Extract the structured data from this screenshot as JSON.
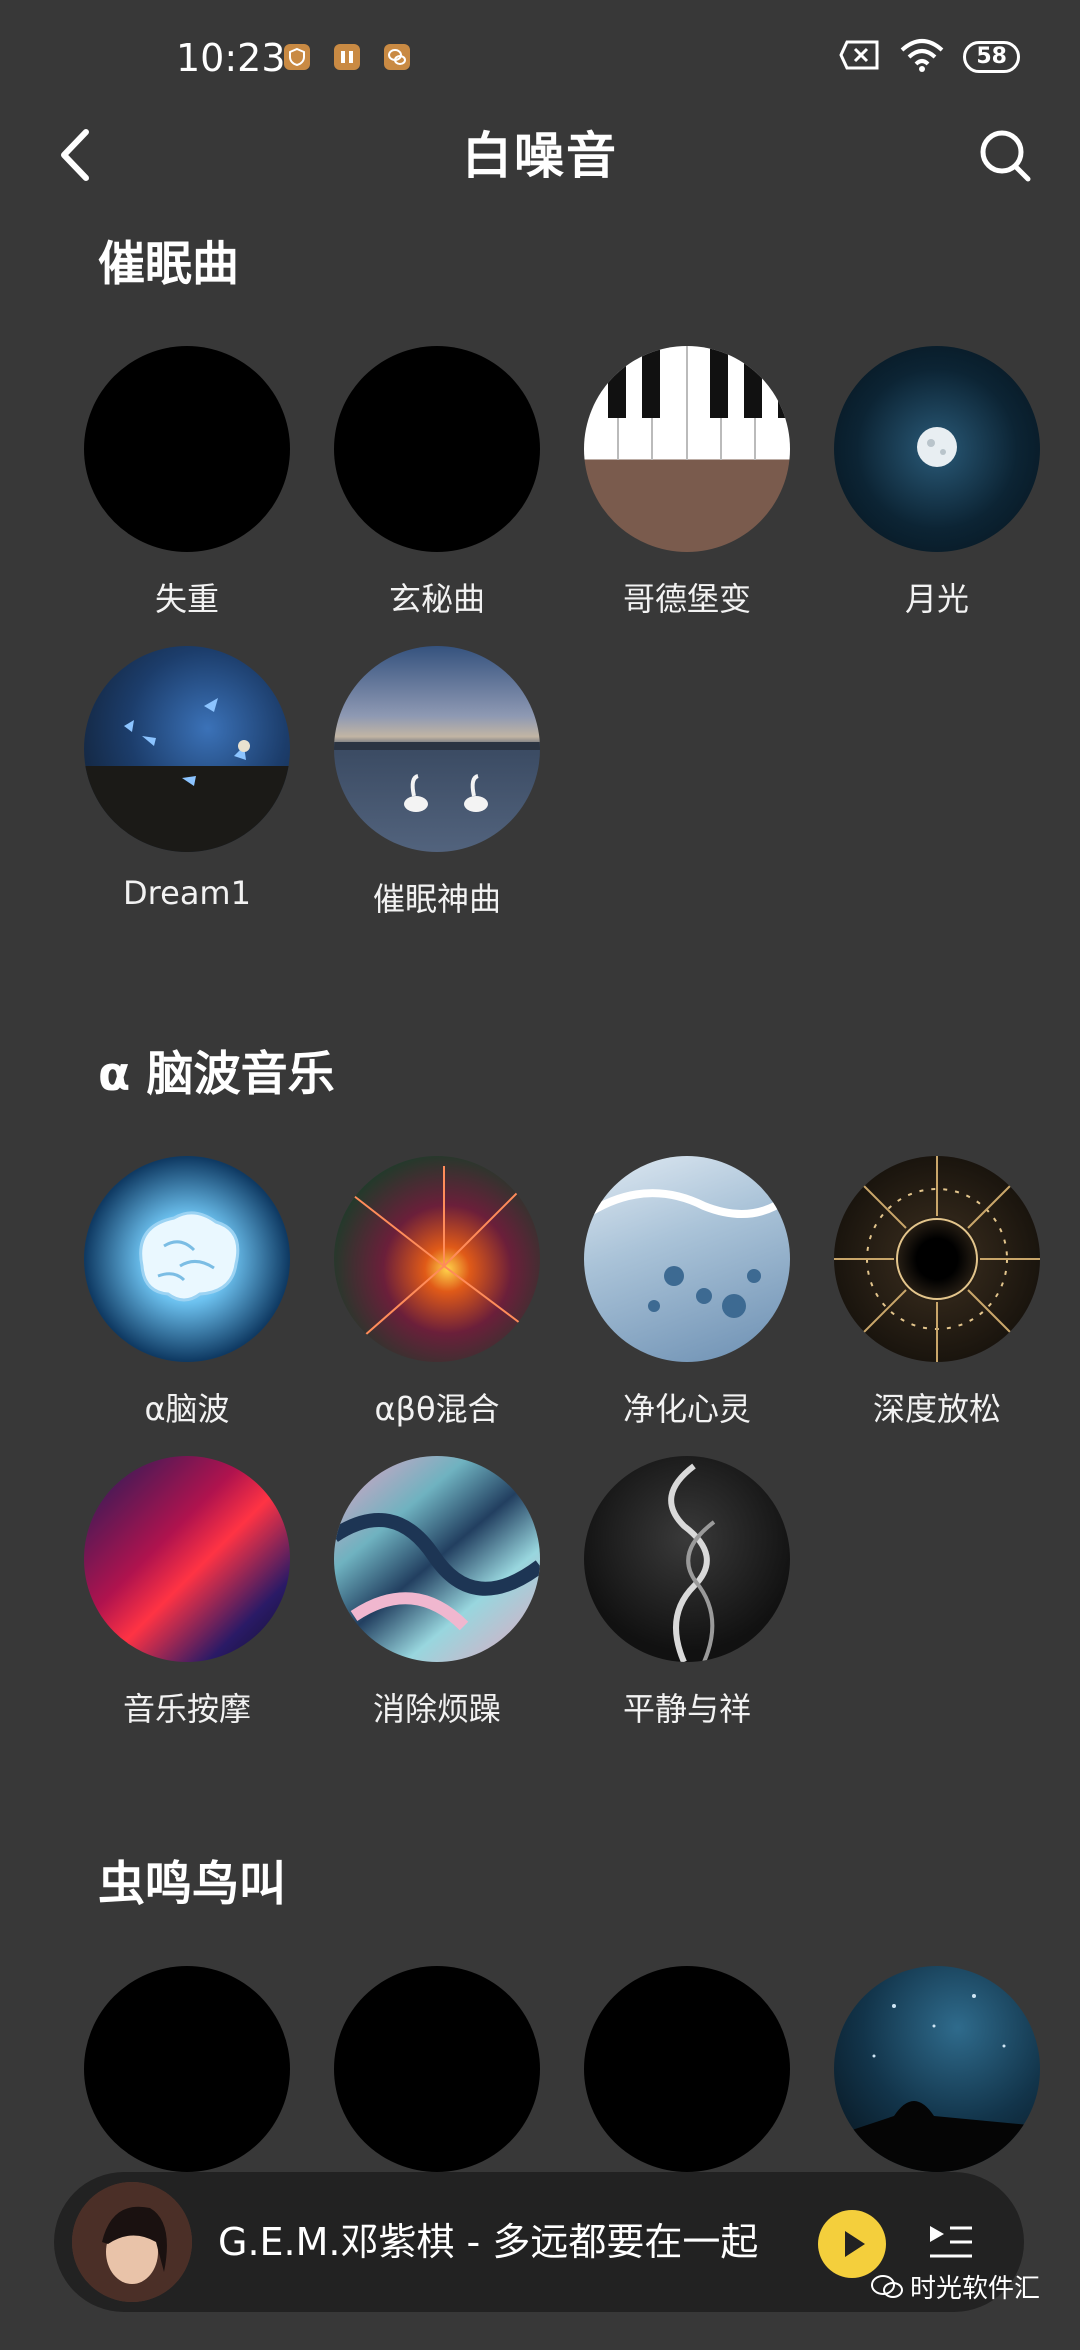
{
  "status_bar": {
    "time": "10:23",
    "battery": "58"
  },
  "header": {
    "title": "白噪音"
  },
  "sections": [
    {
      "title": "催眠曲",
      "items": [
        "失重",
        "玄秘曲",
        "哥德堡变",
        "月光",
        "Dream1",
        "催眠神曲"
      ]
    },
    {
      "title": "α 脑波音乐",
      "items": [
        "α脑波",
        "αβθ混合",
        "净化心灵",
        "深度放松",
        "音乐按摩",
        "消除烦躁",
        "平静与祥"
      ]
    },
    {
      "title": "虫鸣鸟叫",
      "items": [
        "",
        "",
        "",
        ""
      ]
    }
  ],
  "player": {
    "now_playing": "G.E.M.邓紫棋 - 多远都要在一起"
  },
  "watermark": "时光软件汇",
  "colors": {
    "background": "#383838",
    "player_bar": "#222222",
    "play_button": "#f4cf3c",
    "notif_icon": "#c98a43"
  }
}
